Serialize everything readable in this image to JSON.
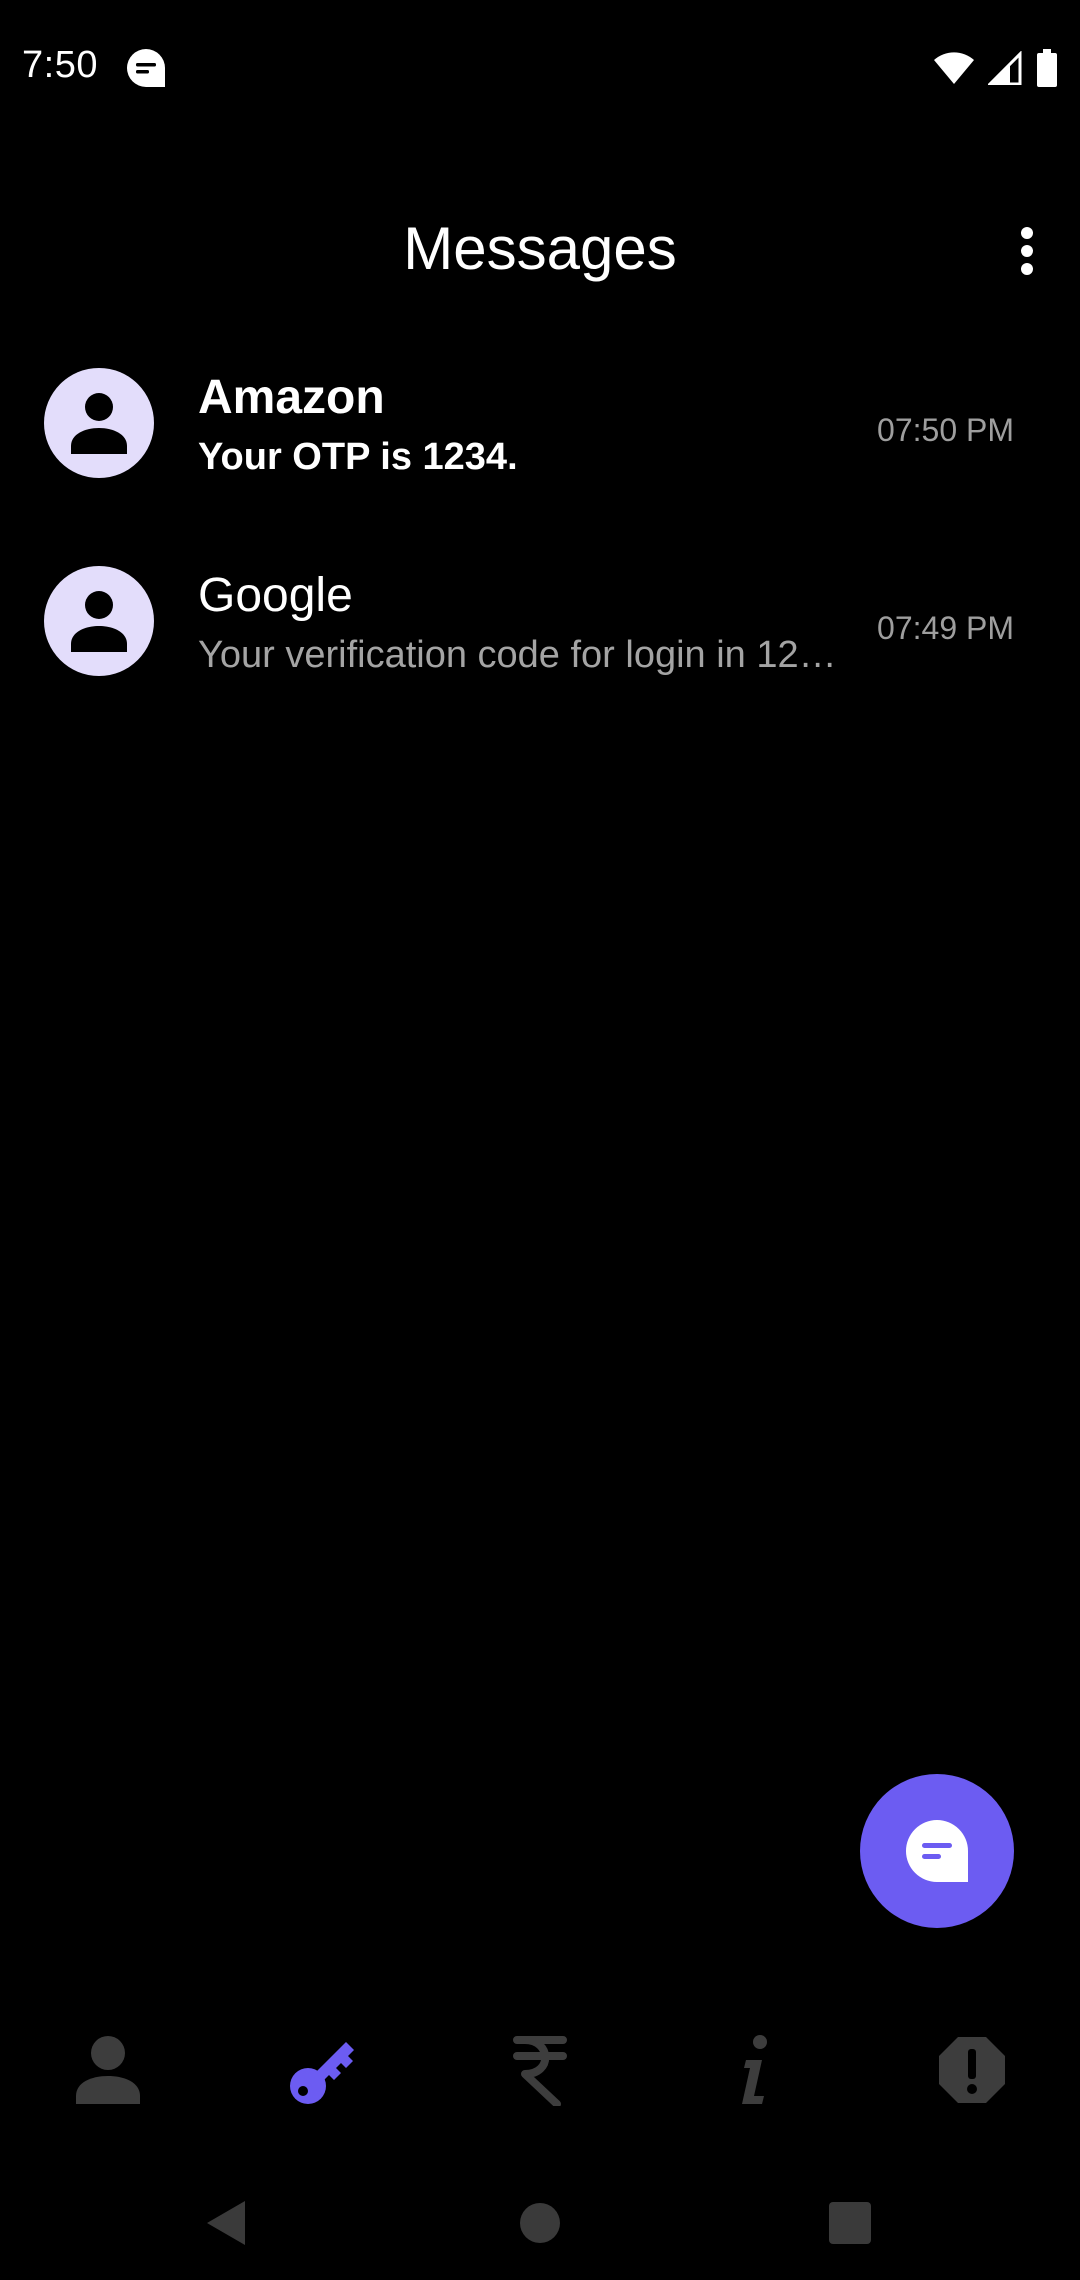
{
  "status_bar": {
    "time": "7:50",
    "notification_icon": "message-icon",
    "icons": [
      "wifi-icon",
      "signal-icon",
      "battery-icon"
    ]
  },
  "header": {
    "title": "Messages",
    "menu_icon": "more-vert-icon"
  },
  "conversations": [
    {
      "name": "Amazon",
      "preview": "Your OTP is 1234.",
      "time": "07:50 PM",
      "unread": true,
      "avatar_icon": "person-icon"
    },
    {
      "name": "Google",
      "preview": "Your verification code for login in 12…",
      "time": "07:49 PM",
      "unread": false,
      "avatar_icon": "person-icon"
    }
  ],
  "fab": {
    "icon": "new-message-icon"
  },
  "bottom_nav": {
    "items": [
      {
        "icon": "person-icon",
        "active": false
      },
      {
        "icon": "key-icon",
        "active": true
      },
      {
        "icon": "rupee-icon",
        "active": false
      },
      {
        "icon": "info-icon",
        "active": false
      },
      {
        "icon": "alert-icon",
        "active": false
      }
    ]
  },
  "system_nav": [
    "back-icon",
    "home-icon",
    "recents-icon"
  ],
  "colors": {
    "background": "#000000",
    "accent": "#6c5cf2",
    "avatar_bg": "#e3ddfb",
    "inactive_icon": "#3d3d3d",
    "secondary_text": "#a4a4a4"
  }
}
